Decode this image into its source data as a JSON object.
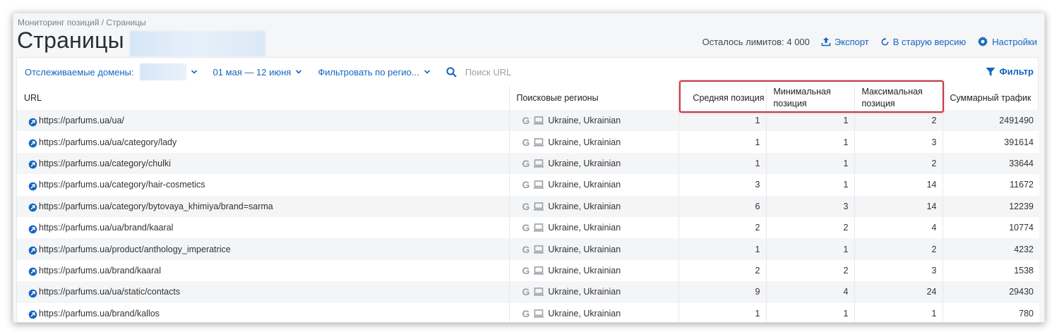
{
  "breadcrumb": "Мониторинг позиций / Страницы",
  "title": "Страницы",
  "header": {
    "limits": "Осталось лимитов: 4 000",
    "export": "Экспорт",
    "old_version": "В старую версию",
    "settings": "Настройки"
  },
  "toolbar": {
    "domains": "Отслеживаемые домены:",
    "dates": "01 мая — 12 июня",
    "region": "Фильтровать по регио...",
    "search_placeholder": "Поиск URL",
    "filter": "Фильтр"
  },
  "columns": {
    "url": "URL",
    "regions": "Поисковые регионы",
    "avg": "Средняя позиция",
    "min_1": "Минимальная",
    "min_2": "позиция",
    "max_1": "Максимальная",
    "max_2": "позиция",
    "traffic": "Суммарный трафик"
  },
  "rows": [
    {
      "url": "https://parfums.ua/ua/",
      "region": "Ukraine, Ukrainian",
      "avg": "1",
      "min": "1",
      "max": "2",
      "traffic": "2491490"
    },
    {
      "url": "https://parfums.ua/ua/category/lady",
      "region": "Ukraine, Ukrainian",
      "avg": "1",
      "min": "1",
      "max": "3",
      "traffic": "391614"
    },
    {
      "url": "https://parfums.ua/category/chulki",
      "region": "Ukraine, Ukrainian",
      "avg": "1",
      "min": "1",
      "max": "2",
      "traffic": "33644"
    },
    {
      "url": "https://parfums.ua/category/hair-cosmetics",
      "region": "Ukraine, Ukrainian",
      "avg": "3",
      "min": "1",
      "max": "14",
      "traffic": "11672"
    },
    {
      "url": "https://parfums.ua/category/bytovaya_khimiya/brand=sarma",
      "region": "Ukraine, Ukrainian",
      "avg": "6",
      "min": "3",
      "max": "14",
      "traffic": "12239"
    },
    {
      "url": "https://parfums.ua/ua/brand/kaaral",
      "region": "Ukraine, Ukrainian",
      "avg": "2",
      "min": "2",
      "max": "4",
      "traffic": "10774"
    },
    {
      "url": "https://parfums.ua/product/anthology_imperatrice",
      "region": "Ukraine, Ukrainian",
      "avg": "1",
      "min": "1",
      "max": "2",
      "traffic": "4232"
    },
    {
      "url": "https://parfums.ua/brand/kaaral",
      "region": "Ukraine, Ukrainian",
      "avg": "2",
      "min": "2",
      "max": "3",
      "traffic": "1538"
    },
    {
      "url": "https://parfums.ua/ua/static/contacts",
      "region": "Ukraine, Ukrainian",
      "avg": "9",
      "min": "4",
      "max": "24",
      "traffic": "29430"
    },
    {
      "url": "https://parfums.ua/brand/kallos",
      "region": "Ukraine, Ukrainian",
      "avg": "1",
      "min": "1",
      "max": "1",
      "traffic": "780"
    }
  ],
  "icons": {
    "row_link": "external-link-icon",
    "engine": "google-icon",
    "device": "desktop-icon"
  },
  "colors": {
    "accent": "#1565c0",
    "highlight": "#c43a43"
  }
}
